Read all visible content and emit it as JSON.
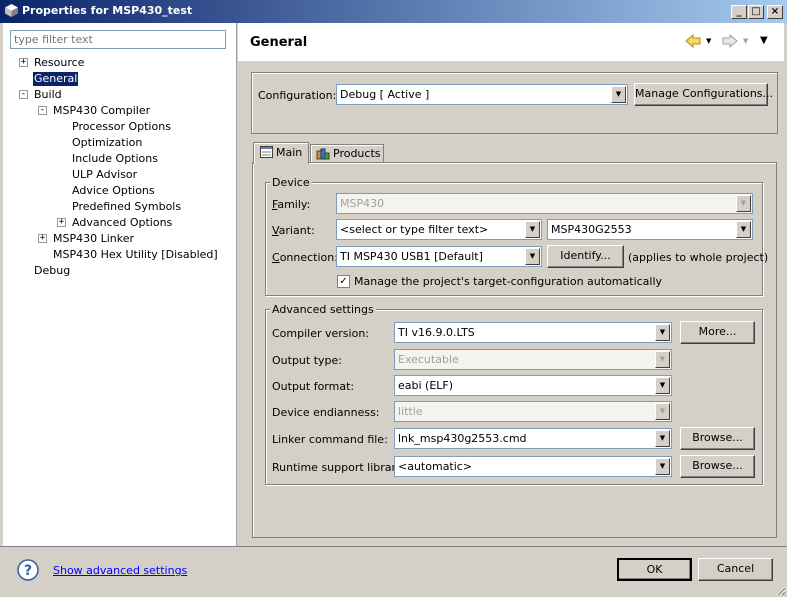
{
  "window": {
    "title": "Properties for MSP430_test"
  },
  "filter": {
    "placeholder": "type filter text"
  },
  "tree": {
    "resource": "Resource",
    "general": "General",
    "build": "Build",
    "compiler": "MSP430 Compiler",
    "processor_options": "Processor Options",
    "optimization": "Optimization",
    "include_options": "Include Options",
    "ulp_advisor": "ULP Advisor",
    "advice_options": "Advice Options",
    "predefined_symbols": "Predefined Symbols",
    "advanced_options": "Advanced Options",
    "linker": "MSP430 Linker",
    "hex_utility": "MSP430 Hex Utility  [Disabled]",
    "debug": "Debug"
  },
  "page": {
    "title": "General"
  },
  "configuration": {
    "label": "Configuration:",
    "value": "Debug  [ Active ]",
    "manage_button": "Manage Configurations..."
  },
  "tabs": {
    "main": "Main",
    "products": "Products"
  },
  "device": {
    "group_title": "Device",
    "family_label": "Family:",
    "family_value": "MSP430",
    "variant_label": "Variant:",
    "variant_filter": "<select or type filter text>",
    "variant_value": "MSP430G2553",
    "connection_label": "Connection:",
    "connection_value": "TI MSP430 USB1 [Default]",
    "identify_button": "Identify...",
    "applies_note": "(applies to whole project)",
    "manage_checkbox": "Manage the project's target-configuration automatically"
  },
  "advanced": {
    "group_title": "Advanced settings",
    "compiler_label": "Compiler version:",
    "compiler_value": "TI v16.9.0.LTS",
    "more_button": "More...",
    "output_type_label": "Output type:",
    "output_type_value": "Executable",
    "output_format_label": "Output format:",
    "output_format_value": "eabi (ELF)",
    "endianness_label": "Device endianness:",
    "endianness_value": "little",
    "linker_cmd_label": "Linker command file:",
    "linker_cmd_value": "lnk_msp430g2553.cmd",
    "browse_button": "Browse...",
    "runtime_label": "Runtime support library:",
    "runtime_value": "<automatic>"
  },
  "footer": {
    "show_advanced": "Show advanced settings",
    "ok": "OK",
    "cancel": "Cancel"
  },
  "colors": {
    "title_bar": "#0a246a",
    "selection": "#0a246a",
    "link": "#0000ff"
  }
}
